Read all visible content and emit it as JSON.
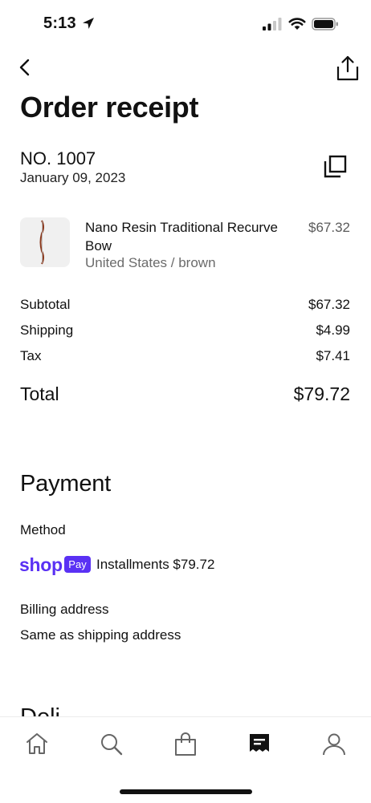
{
  "status_bar": {
    "time": "5:13"
  },
  "header": {
    "title": "Order receipt"
  },
  "order": {
    "number": "NO. 1007",
    "date": "January 09, 2023"
  },
  "item": {
    "name": "Nano Resin Traditional Recurve Bow",
    "variant": "United States / brown",
    "price": "$67.32"
  },
  "summary": {
    "subtotal_label": "Subtotal",
    "subtotal": "$67.32",
    "shipping_label": "Shipping",
    "shipping": "$4.99",
    "tax_label": "Tax",
    "tax": "$7.41",
    "total_label": "Total",
    "total": "$79.72"
  },
  "payment": {
    "heading": "Payment",
    "method_label": "Method",
    "shop_logo_text": "shop",
    "pay_badge": "Pay",
    "installments": "Installments $79.72",
    "billing_label": "Billing address",
    "billing_value": "Same as shipping address"
  },
  "next_section_peek": "Deli",
  "tabbar": {
    "items": [
      "home-icon",
      "search-icon",
      "shopping-bag-icon",
      "orders-icon",
      "account-icon"
    ],
    "active": "orders-icon"
  },
  "colors": {
    "shop_purple": "#5a31f4",
    "text": "#111111",
    "muted": "#6b6b6b"
  }
}
